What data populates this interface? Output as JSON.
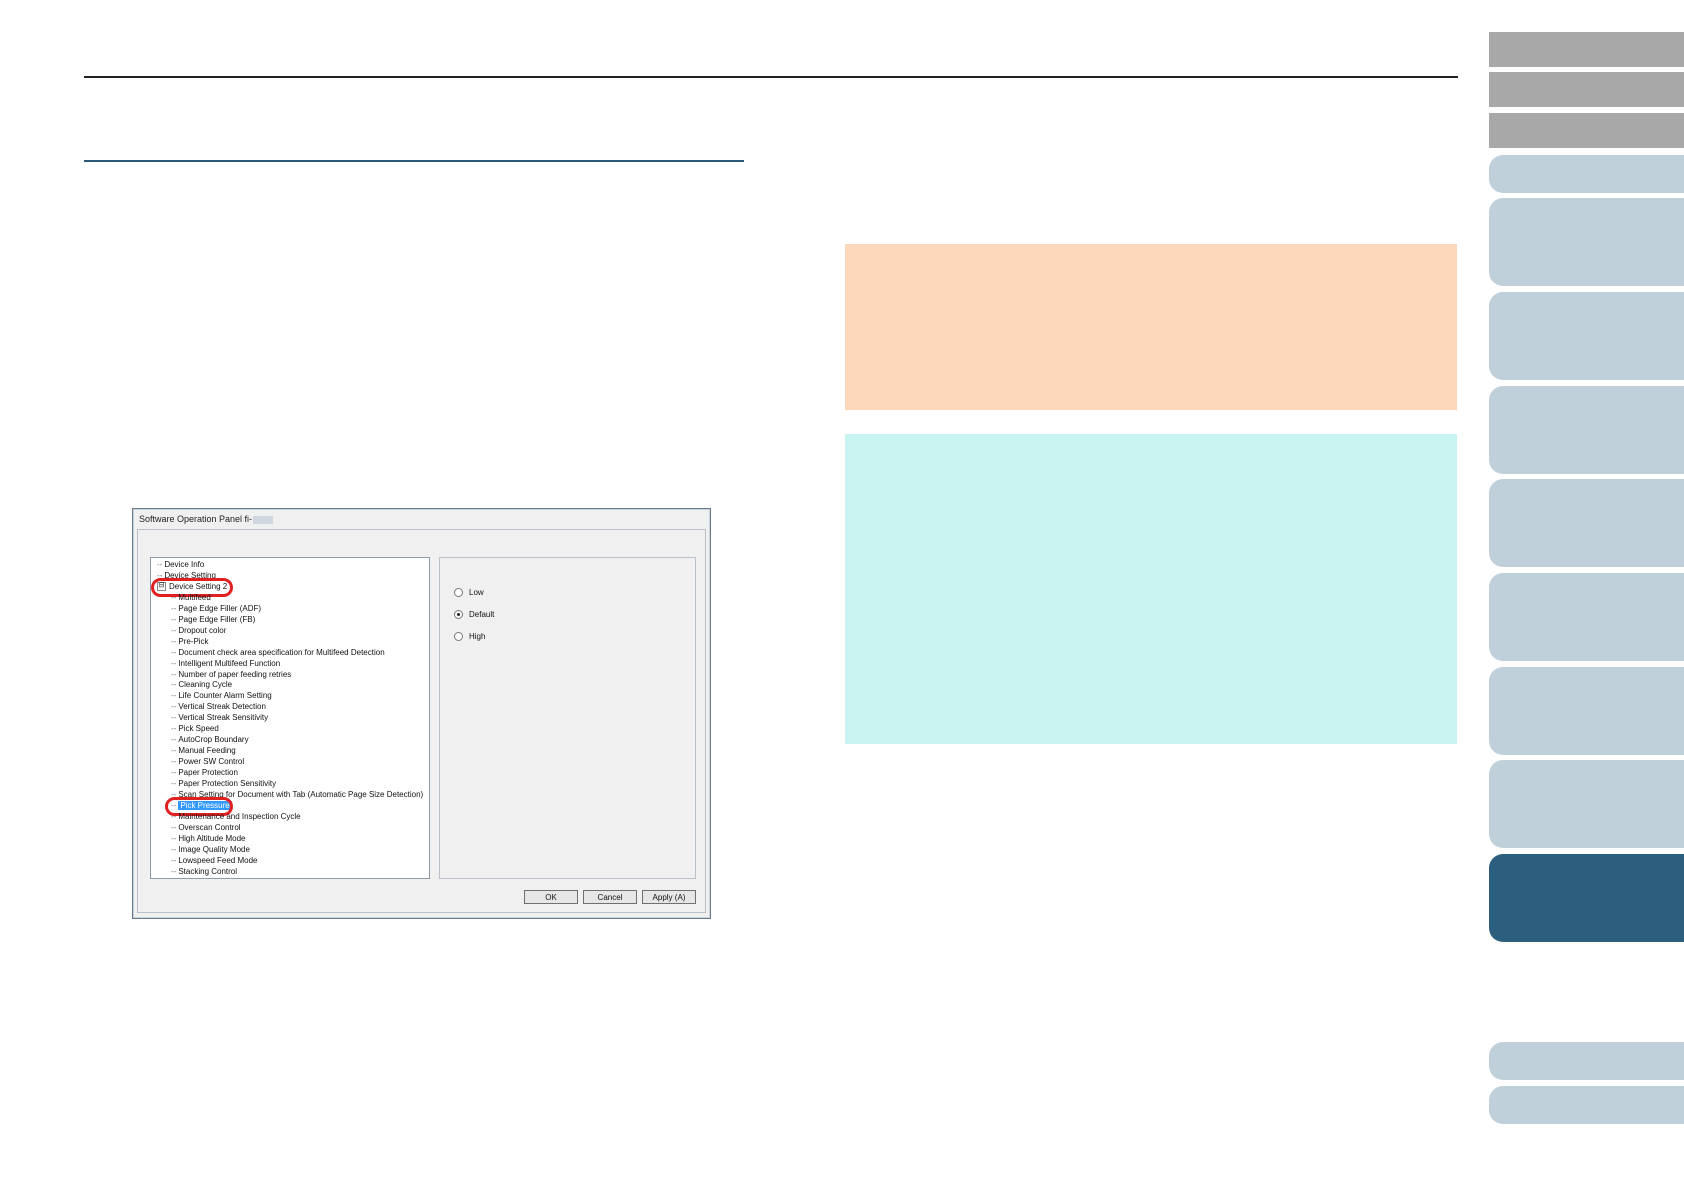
{
  "dialog": {
    "title": "Software Operation Panel fi-",
    "tree": {
      "items": [
        {
          "label": "Device Info"
        },
        {
          "label": "Device Setting"
        },
        {
          "label": "Device Setting 2"
        },
        {
          "label": "Multifeed"
        },
        {
          "label": "Page Edge Filler (ADF)"
        },
        {
          "label": "Page Edge Filler (FB)"
        },
        {
          "label": "Dropout color"
        },
        {
          "label": "Pre-Pick"
        },
        {
          "label": "Document check area specification for Multifeed Detection"
        },
        {
          "label": "Intelligent Multifeed Function"
        },
        {
          "label": "Number of paper feeding retries"
        },
        {
          "label": "Cleaning Cycle"
        },
        {
          "label": "Life Counter Alarm Setting"
        },
        {
          "label": "Vertical Streak Detection"
        },
        {
          "label": "Vertical Streak Sensitivity"
        },
        {
          "label": "Pick Speed"
        },
        {
          "label": "AutoCrop Boundary"
        },
        {
          "label": "Manual Feeding"
        },
        {
          "label": "Power SW Control"
        },
        {
          "label": "Paper Protection"
        },
        {
          "label": "Paper Protection Sensitivity"
        },
        {
          "label": "Scan Setting for Document with Tab (Automatic Page Size Detection)"
        },
        {
          "label": "Pick Pressure"
        },
        {
          "label": "Maintenance and Inspection Cycle"
        },
        {
          "label": "Overscan Control"
        },
        {
          "label": "High Altitude Mode"
        },
        {
          "label": "Image Quality Mode"
        },
        {
          "label": "Lowspeed Feed Mode"
        },
        {
          "label": "Stacking Control"
        }
      ],
      "expander": "⊟",
      "selected": "Pick Pressure"
    },
    "options": [
      {
        "label": "Low",
        "checked": false
      },
      {
        "label": "Default",
        "checked": true
      },
      {
        "label": "High",
        "checked": false
      }
    ],
    "buttons": {
      "ok": "OK",
      "cancel": "Cancel",
      "apply": "Apply (A)"
    }
  },
  "colors": {
    "warning_box": "#fdd8ba",
    "hint_box": "#c8f3f1",
    "tab_gray": "#a8a8a8",
    "tab_blue": "#bfd0db",
    "tab_active": "#2b5f7d",
    "highlight": "#e02020",
    "selection": "#3399ff"
  },
  "side_tabs": [
    {
      "style": "gray"
    },
    {
      "style": "gray"
    },
    {
      "style": "gray"
    },
    {
      "style": "blue"
    },
    {
      "style": "blue"
    },
    {
      "style": "blue"
    },
    {
      "style": "blue"
    },
    {
      "style": "blue"
    },
    {
      "style": "blue"
    },
    {
      "style": "blue"
    },
    {
      "style": "blue"
    },
    {
      "style": "active"
    },
    {
      "style": "blue"
    },
    {
      "style": "blue"
    }
  ]
}
